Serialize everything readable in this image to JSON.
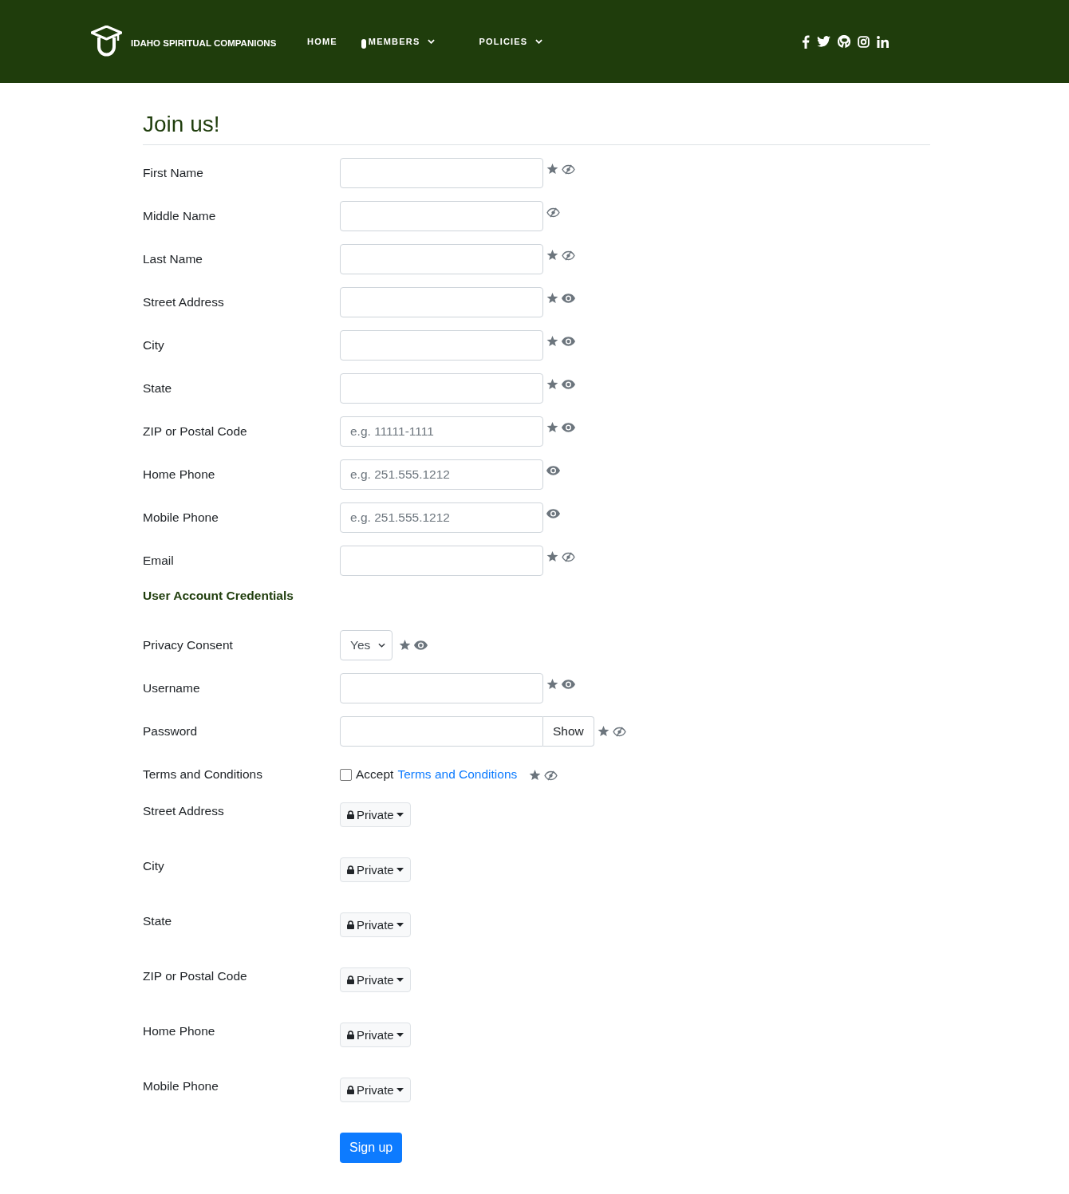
{
  "header": {
    "brand": "IDAHO SPIRITUAL COMPANIONS",
    "nav": [
      {
        "label": "HOME",
        "dropdown": false,
        "marker": false
      },
      {
        "label": "MEMBERS",
        "dropdown": true,
        "marker": true
      },
      {
        "label": "POLICIES",
        "dropdown": true,
        "marker": false
      }
    ]
  },
  "title": "Join us!",
  "rows": [
    {
      "kind": "input",
      "label": "First Name",
      "required": true,
      "visible": false
    },
    {
      "kind": "input",
      "label": "Middle Name",
      "required": false,
      "visible": false
    },
    {
      "kind": "input",
      "label": "Last Name",
      "required": true,
      "visible": false
    },
    {
      "kind": "input",
      "label": "Street Address",
      "required": true,
      "visible": true
    },
    {
      "kind": "input",
      "label": "City",
      "required": true,
      "visible": true
    },
    {
      "kind": "input",
      "label": "State",
      "required": true,
      "visible": true
    },
    {
      "kind": "input",
      "label": "ZIP or Postal Code",
      "placeholder": "e.g. 11111-1111",
      "required": true,
      "visible": true
    },
    {
      "kind": "input",
      "label": "Home Phone",
      "placeholder": "e.g. 251.555.1212",
      "required": false,
      "visible": true
    },
    {
      "kind": "input",
      "label": "Mobile Phone",
      "placeholder": "e.g. 251.555.1212",
      "required": false,
      "visible": true
    },
    {
      "kind": "input",
      "label": "Email",
      "required": true,
      "visible": false
    },
    {
      "kind": "heading",
      "label": "User Account Credentials"
    },
    {
      "kind": "select",
      "label": "Privacy Consent",
      "value": "Yes",
      "required": true,
      "visible": true
    },
    {
      "kind": "input",
      "label": "Username",
      "required": true,
      "visible": true
    },
    {
      "kind": "password",
      "label": "Password",
      "button": "Show",
      "required": true,
      "visible": false
    },
    {
      "kind": "checkbox",
      "label": "Terms and Conditions",
      "text": "Accept",
      "link": "Terms and Conditions",
      "checked": false,
      "required": true,
      "visible": false
    },
    {
      "kind": "privacy",
      "label": "Street Address",
      "button": "Private"
    },
    {
      "kind": "privacy",
      "label": "City",
      "button": "Private"
    },
    {
      "kind": "privacy",
      "label": "State",
      "button": "Private"
    },
    {
      "kind": "privacy",
      "label": "ZIP or Postal Code",
      "button": "Private"
    },
    {
      "kind": "privacy",
      "label": "Home Phone",
      "button": "Private"
    },
    {
      "kind": "privacy",
      "label": "Mobile Phone",
      "button": "Private"
    }
  ],
  "submit": "Sign up"
}
